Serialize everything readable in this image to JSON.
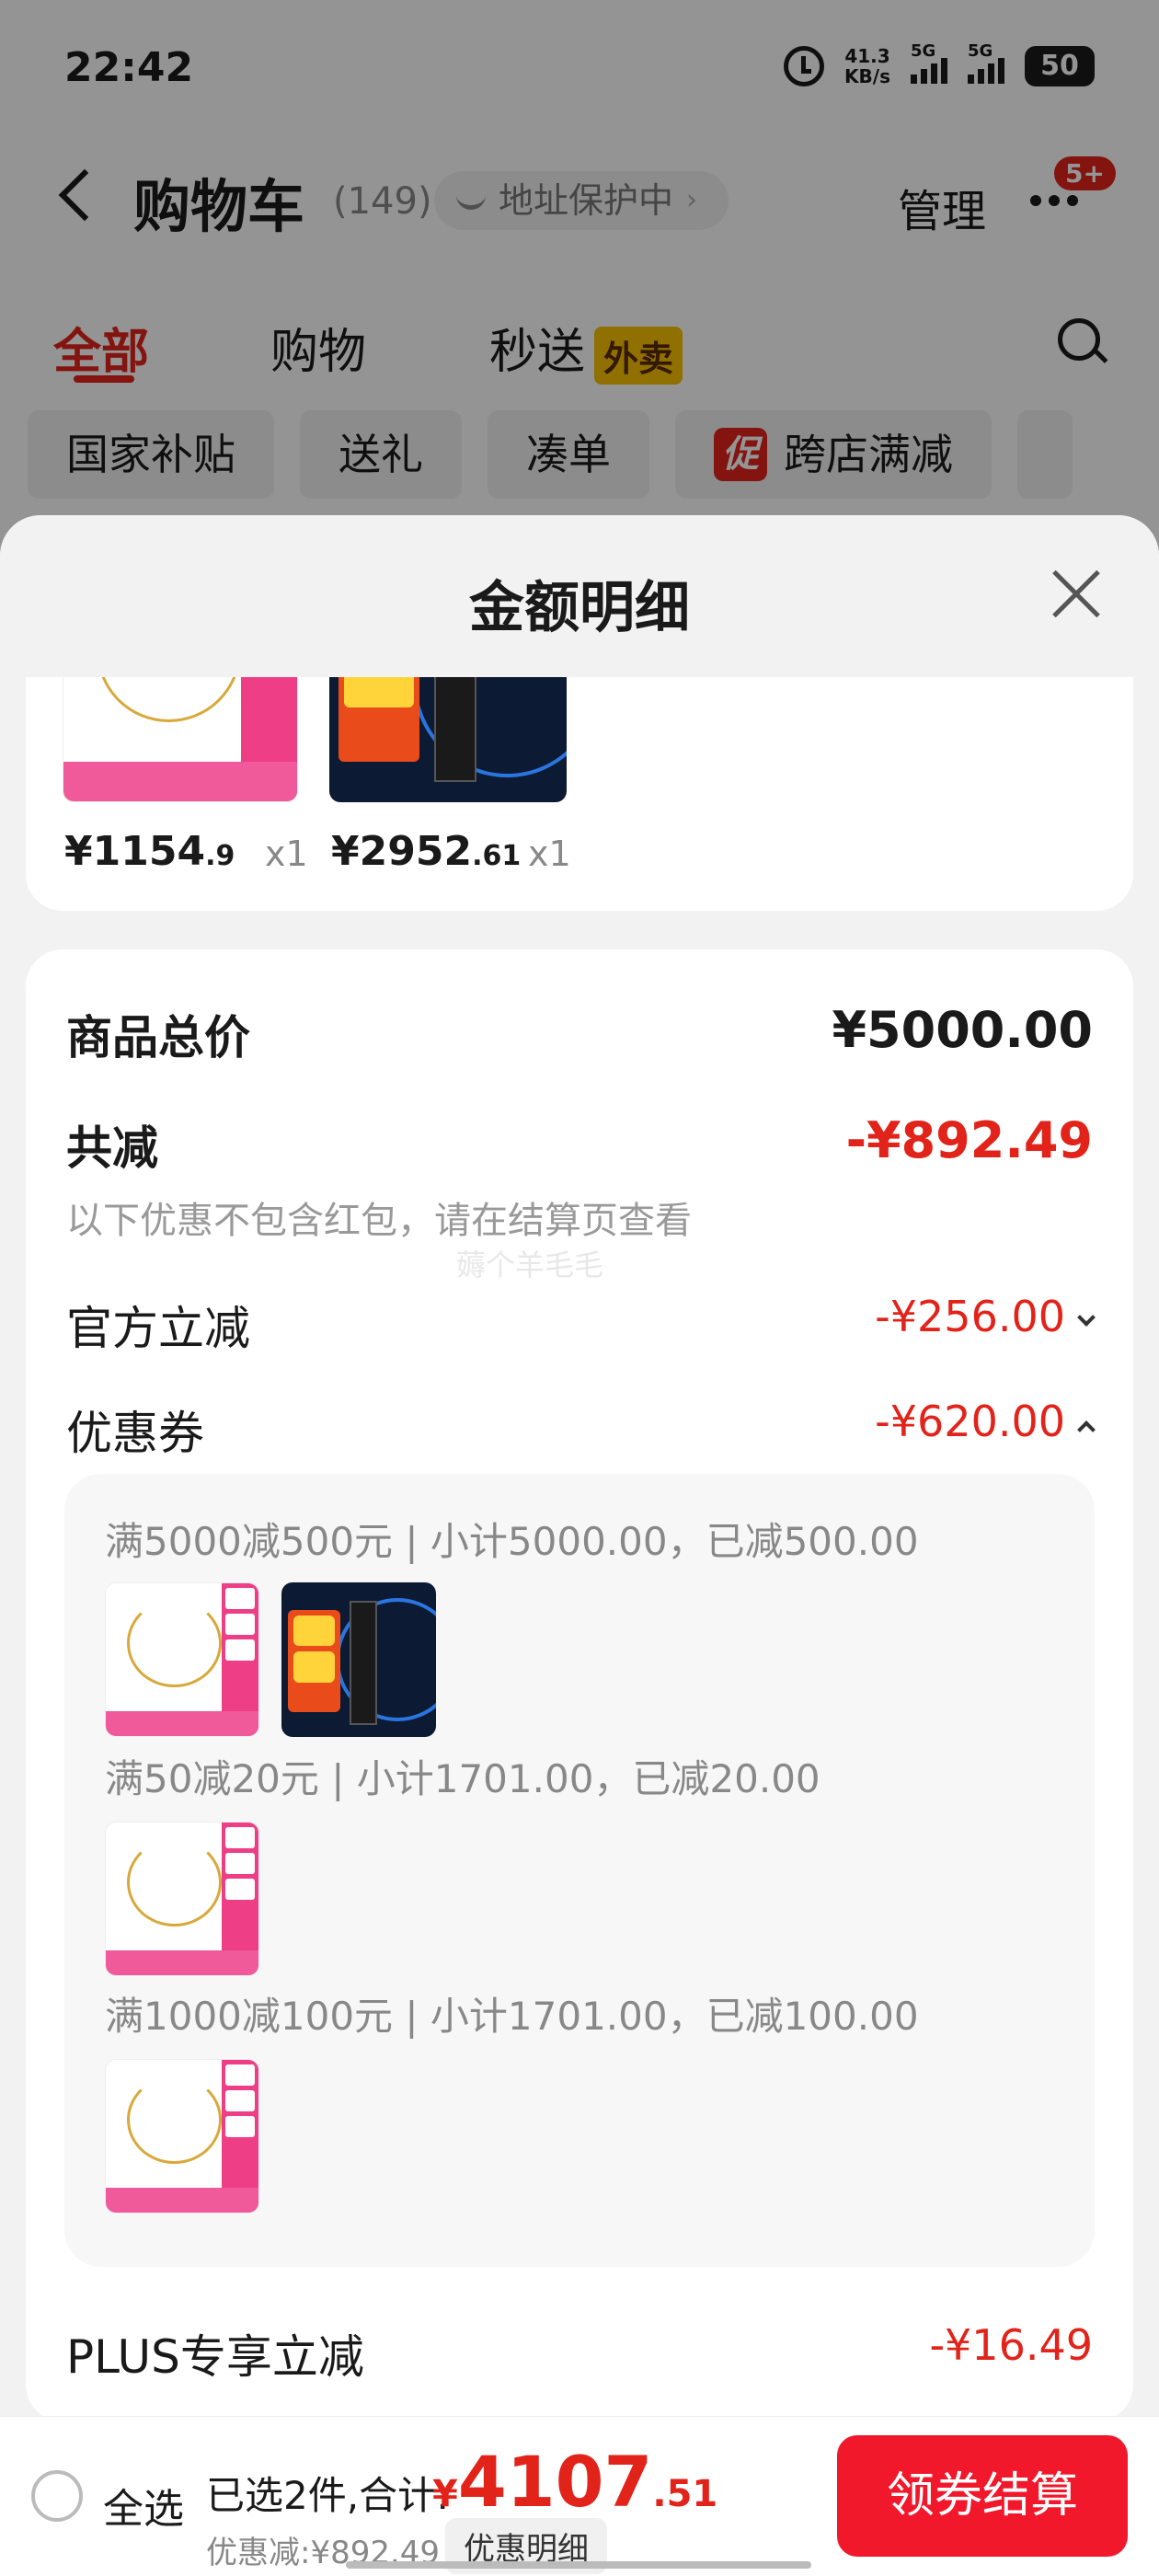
{
  "status": {
    "time": "22:42",
    "net_speed_value": "41.3",
    "net_speed_unit": "KB/s",
    "sig1": "5G",
    "sig2": "5G",
    "battery": "50"
  },
  "header": {
    "title": "购物车",
    "count": "(149)",
    "address": "地址保护中",
    "manage": "管理",
    "msg_badge": "5+"
  },
  "tabs": {
    "all": "全部",
    "shop": "购物",
    "express": "秒送",
    "takeout": "外卖"
  },
  "chips": {
    "c1": "国家补贴",
    "c2": "送礼",
    "c3": "凑单",
    "promo_tag": "促",
    "c4": "跨店满减"
  },
  "sheet": {
    "title": "金额明细",
    "items": [
      {
        "price_int": "¥1154",
        "price_dec": ".9",
        "qty": "x1"
      },
      {
        "price_int": "¥2952",
        "price_dec": ".61",
        "qty": "x1"
      }
    ],
    "total_label": "商品总价",
    "total_value": "¥5000.00",
    "reduce_label": "共减",
    "reduce_value": "-¥892.49",
    "reduce_note": "以下优惠不包含红包，请在结算页查看",
    "watermark": "薅个羊毛毛",
    "official_label": "官方立减",
    "official_value": "-¥256.00",
    "coupon_label": "优惠券",
    "coupon_value": "-¥620.00",
    "coupons": [
      "满5000减500元 | 小计5000.00，已减500.00",
      "满50减20元 | 小计1701.00，已减20.00",
      "满1000减100元 | 小计1701.00，已减100.00"
    ],
    "plus_label": "PLUS专享立减",
    "plus_value": "-¥16.49"
  },
  "bottom": {
    "select_all": "全选",
    "selected_info": "已选2件,合计:",
    "total_yen": "¥",
    "total_int": "4107",
    "total_dec": ".51",
    "discount": "优惠减:¥892.49",
    "detail_btn": "优惠明细",
    "checkout": "领券结算"
  },
  "colors": {
    "accent": "#e2231a",
    "checkout": "#f2182c"
  }
}
